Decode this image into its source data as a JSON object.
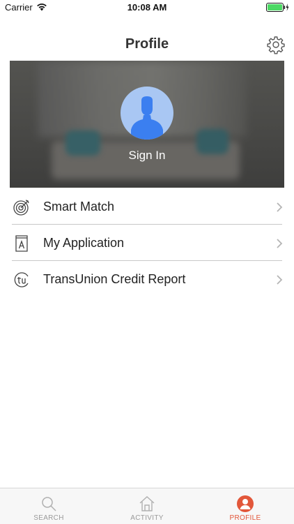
{
  "status_bar": {
    "carrier": "Carrier",
    "time": "10:08 AM"
  },
  "nav": {
    "title": "Profile"
  },
  "hero": {
    "sign_in_label": "Sign In"
  },
  "menu": {
    "items": [
      {
        "label": "Smart Match",
        "icon": "target-icon"
      },
      {
        "label": "My Application",
        "icon": "application-icon"
      },
      {
        "label": "TransUnion Credit Report",
        "icon": "transunion-icon"
      }
    ]
  },
  "tabs": [
    {
      "label": "SEARCH",
      "icon": "search-icon",
      "active": false
    },
    {
      "label": "ACTIVITY",
      "icon": "home-icon",
      "active": false
    },
    {
      "label": "PROFILE",
      "icon": "profile-icon",
      "active": true
    }
  ],
  "colors": {
    "accent": "#e2573a",
    "avatar_bg": "#a9c7f3",
    "avatar_figure": "#3b7ff0",
    "tab_inactive": "#9a9a9a",
    "battery": "#4cd964"
  }
}
